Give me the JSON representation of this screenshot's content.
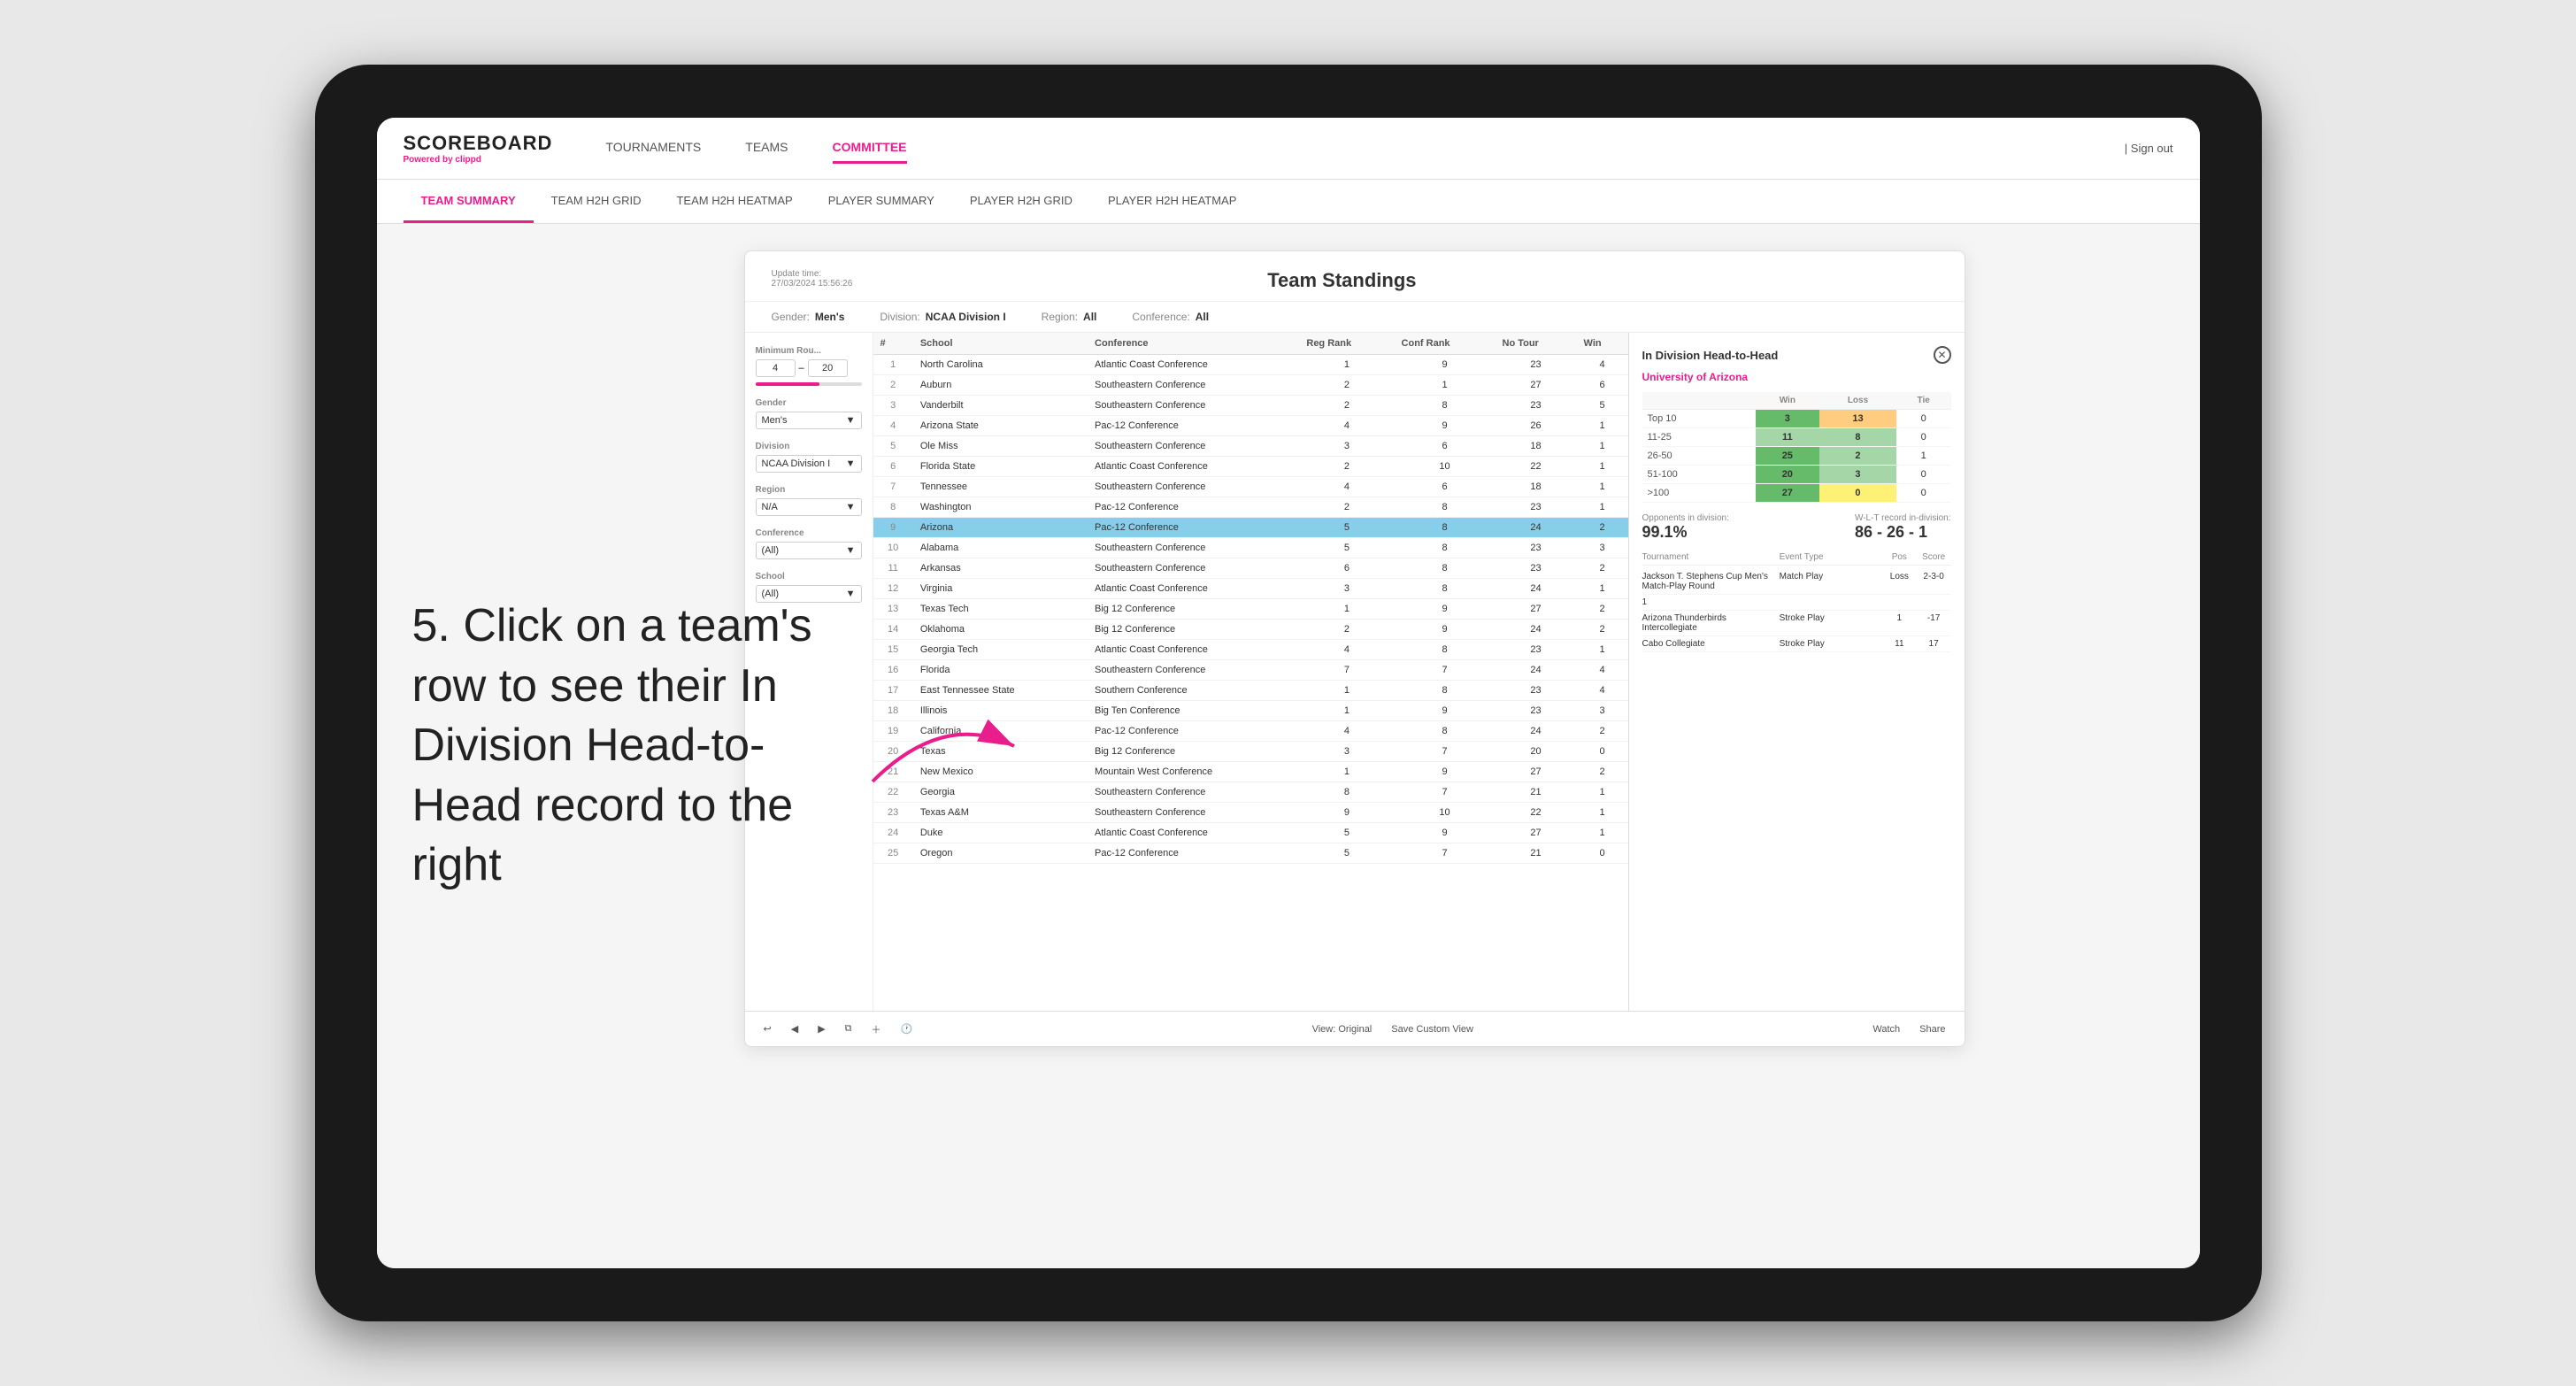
{
  "app": {
    "logo_title": "SCOREBOARD",
    "logo_subtitle_prefix": "Powered by ",
    "logo_subtitle_brand": "clippd"
  },
  "nav": {
    "links": [
      "TOURNAMENTS",
      "TEAMS",
      "COMMITTEE"
    ],
    "active": "COMMITTEE",
    "sign_out": "Sign out"
  },
  "sub_nav": {
    "links": [
      "TEAM SUMMARY",
      "TEAM H2H GRID",
      "TEAM H2H HEATMAP",
      "PLAYER SUMMARY",
      "PLAYER H2H GRID",
      "PLAYER H2H HEATMAP"
    ],
    "active": "PLAYER SUMMARY"
  },
  "panel": {
    "update_label": "Update time:",
    "update_time": "27/03/2024 15:56:26",
    "title": "Team Standings",
    "filters": {
      "gender_label": "Gender:",
      "gender_value": "Men's",
      "division_label": "Division:",
      "division_value": "NCAA Division I",
      "region_label": "Region:",
      "region_value": "All",
      "conference_label": "Conference:",
      "conference_value": "All"
    }
  },
  "left_filters": {
    "min_rounds_label": "Minimum Rou...",
    "min_rounds_value": "4",
    "min_rounds_max": "20",
    "gender_label": "Gender",
    "gender_value": "Men's",
    "division_label": "Division",
    "division_value": "NCAA Division I",
    "region_label": "Region",
    "region_value": "N/A",
    "conference_label": "Conference",
    "conference_value": "(All)",
    "school_label": "School",
    "school_value": "(All)"
  },
  "table": {
    "columns": [
      "#",
      "School",
      "Conference",
      "Reg Rank",
      "Conf Rank",
      "No Tour",
      "Win"
    ],
    "rows": [
      {
        "rank": 1,
        "school": "North Carolina",
        "conference": "Atlantic Coast Conference",
        "reg_rank": 1,
        "conf_rank": 9,
        "no_tour": 23,
        "win": 4
      },
      {
        "rank": 2,
        "school": "Auburn",
        "conference": "Southeastern Conference",
        "reg_rank": 2,
        "conf_rank": 1,
        "no_tour": 27,
        "win": 6
      },
      {
        "rank": 3,
        "school": "Vanderbilt",
        "conference": "Southeastern Conference",
        "reg_rank": 2,
        "conf_rank": 8,
        "no_tour": 23,
        "win": 5
      },
      {
        "rank": 4,
        "school": "Arizona State",
        "conference": "Pac-12 Conference",
        "reg_rank": 4,
        "conf_rank": 9,
        "no_tour": 26,
        "win": 1
      },
      {
        "rank": 5,
        "school": "Ole Miss",
        "conference": "Southeastern Conference",
        "reg_rank": 3,
        "conf_rank": 6,
        "no_tour": 18,
        "win": 1
      },
      {
        "rank": 6,
        "school": "Florida State",
        "conference": "Atlantic Coast Conference",
        "reg_rank": 2,
        "conf_rank": 10,
        "no_tour": 22,
        "win": 1
      },
      {
        "rank": 7,
        "school": "Tennessee",
        "conference": "Southeastern Conference",
        "reg_rank": 4,
        "conf_rank": 6,
        "no_tour": 18,
        "win": 1
      },
      {
        "rank": 8,
        "school": "Washington",
        "conference": "Pac-12 Conference",
        "reg_rank": 2,
        "conf_rank": 8,
        "no_tour": 23,
        "win": 1
      },
      {
        "rank": 9,
        "school": "Arizona",
        "conference": "Pac-12 Conference",
        "reg_rank": 5,
        "conf_rank": 8,
        "no_tour": 24,
        "win": 2,
        "selected": true
      },
      {
        "rank": 10,
        "school": "Alabama",
        "conference": "Southeastern Conference",
        "reg_rank": 5,
        "conf_rank": 8,
        "no_tour": 23,
        "win": 3
      },
      {
        "rank": 11,
        "school": "Arkansas",
        "conference": "Southeastern Conference",
        "reg_rank": 6,
        "conf_rank": 8,
        "no_tour": 23,
        "win": 2
      },
      {
        "rank": 12,
        "school": "Virginia",
        "conference": "Atlantic Coast Conference",
        "reg_rank": 3,
        "conf_rank": 8,
        "no_tour": 24,
        "win": 1
      },
      {
        "rank": 13,
        "school": "Texas Tech",
        "conference": "Big 12 Conference",
        "reg_rank": 1,
        "conf_rank": 9,
        "no_tour": 27,
        "win": 2
      },
      {
        "rank": 14,
        "school": "Oklahoma",
        "conference": "Big 12 Conference",
        "reg_rank": 2,
        "conf_rank": 9,
        "no_tour": 24,
        "win": 2
      },
      {
        "rank": 15,
        "school": "Georgia Tech",
        "conference": "Atlantic Coast Conference",
        "reg_rank": 4,
        "conf_rank": 8,
        "no_tour": 23,
        "win": 1
      },
      {
        "rank": 16,
        "school": "Florida",
        "conference": "Southeastern Conference",
        "reg_rank": 7,
        "conf_rank": 7,
        "no_tour": 24,
        "win": 4
      },
      {
        "rank": 17,
        "school": "East Tennessee State",
        "conference": "Southern Conference",
        "reg_rank": 1,
        "conf_rank": 8,
        "no_tour": 23,
        "win": 4
      },
      {
        "rank": 18,
        "school": "Illinois",
        "conference": "Big Ten Conference",
        "reg_rank": 1,
        "conf_rank": 9,
        "no_tour": 23,
        "win": 3
      },
      {
        "rank": 19,
        "school": "California",
        "conference": "Pac-12 Conference",
        "reg_rank": 4,
        "conf_rank": 8,
        "no_tour": 24,
        "win": 2
      },
      {
        "rank": 20,
        "school": "Texas",
        "conference": "Big 12 Conference",
        "reg_rank": 3,
        "conf_rank": 7,
        "no_tour": 20,
        "win": 0
      },
      {
        "rank": 21,
        "school": "New Mexico",
        "conference": "Mountain West Conference",
        "reg_rank": 1,
        "conf_rank": 9,
        "no_tour": 27,
        "win": 2
      },
      {
        "rank": 22,
        "school": "Georgia",
        "conference": "Southeastern Conference",
        "reg_rank": 8,
        "conf_rank": 7,
        "no_tour": 21,
        "win": 1
      },
      {
        "rank": 23,
        "school": "Texas A&M",
        "conference": "Southeastern Conference",
        "reg_rank": 9,
        "conf_rank": 10,
        "no_tour": 22,
        "win": 1
      },
      {
        "rank": 24,
        "school": "Duke",
        "conference": "Atlantic Coast Conference",
        "reg_rank": 5,
        "conf_rank": 9,
        "no_tour": 27,
        "win": 1
      },
      {
        "rank": 25,
        "school": "Oregon",
        "conference": "Pac-12 Conference",
        "reg_rank": 5,
        "conf_rank": 7,
        "no_tour": 21,
        "win": 0
      }
    ]
  },
  "h2h": {
    "title": "In Division Head-to-Head",
    "team": "University of Arizona",
    "win_label": "Win",
    "loss_label": "Loss",
    "tie_label": "Tie",
    "rows": [
      {
        "range": "Top 10",
        "win": 3,
        "loss": 13,
        "tie": 0,
        "win_color": "green",
        "loss_color": "orange"
      },
      {
        "range": "11-25",
        "win": 11,
        "loss": 8,
        "tie": 0,
        "win_color": "lightgreen",
        "loss_color": "lightgreen"
      },
      {
        "range": "26-50",
        "win": 25,
        "loss": 2,
        "tie": 1,
        "win_color": "green",
        "loss_color": "lightgreen"
      },
      {
        "range": "51-100",
        "win": 20,
        "loss": 3,
        "tie": 0,
        "win_color": "green",
        "loss_color": "lightgreen"
      },
      {
        "range": ">100",
        "win": 27,
        "loss": 0,
        "tie": 0,
        "win_color": "green",
        "loss_color": "yellow"
      }
    ],
    "opponents_label": "Opponents in division:",
    "opponents_value": "99.1%",
    "wlt_label": "W-L-T record in-division:",
    "wlt_value": "86 - 26 - 1",
    "tournaments_title": "Tournament",
    "tournaments_columns": [
      "Tournament",
      "Event Type",
      "Pos",
      "Score"
    ],
    "tournaments": [
      {
        "name": "Jackson T. Stephens Cup Men's Match-Play Round",
        "event": "Match Play",
        "result": "Loss",
        "pos": "2-3-0"
      },
      {
        "name": "1",
        "event": "",
        "pos": "",
        "score": ""
      },
      {
        "name": "Arizona Thunderbirds Intercollegiate",
        "event": "Stroke Play",
        "pos": "1",
        "score": "-17"
      },
      {
        "name": "Cabo Collegiate",
        "event": "Stroke Play",
        "pos": "11",
        "score": "17"
      }
    ]
  },
  "toolbar": {
    "undo": "↩",
    "redo": "↪",
    "view_original": "View: Original",
    "save_custom": "Save Custom View",
    "watch": "Watch",
    "share": "Share"
  },
  "annotation": {
    "text": "5. Click on a team's row to see their In Division Head-to-Head record to the right"
  }
}
